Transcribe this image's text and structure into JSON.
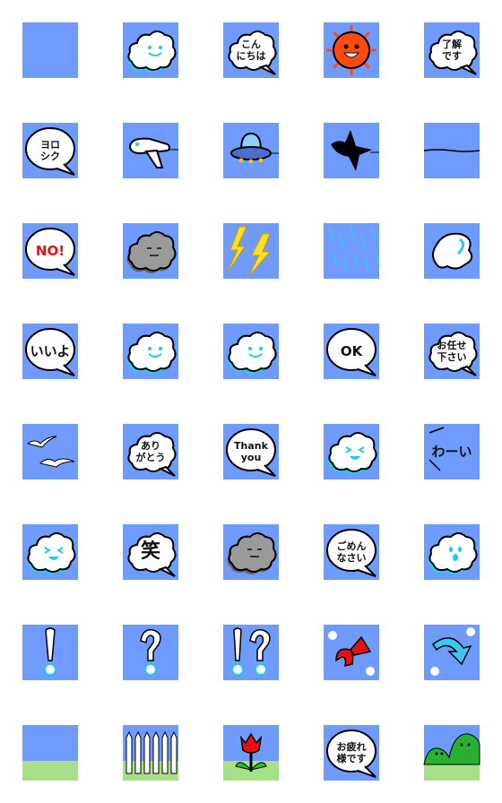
{
  "colors": {
    "tile_bg": "#6f9bff",
    "cloud_shadow": "#22d3f0",
    "sun": "#ff4a10",
    "gray_cloud": "#9a9a9a",
    "lightning": "#ffe020",
    "grass": "#a8e08a",
    "red": "#e81010",
    "arrow_blue": "#3ec8f0"
  },
  "tiles": [
    {
      "icon": "blank"
    },
    {
      "icon": "smiling-cloud"
    },
    {
      "icon": "speech-cloud",
      "lines": [
        "こん",
        "にちは"
      ]
    },
    {
      "icon": "sun"
    },
    {
      "icon": "speech-cloud",
      "lines": [
        "了解",
        "です"
      ]
    },
    {
      "icon": "speech-bubble",
      "lines": [
        "ヨロ",
        "シク"
      ]
    },
    {
      "icon": "airplane"
    },
    {
      "icon": "ufo"
    },
    {
      "icon": "crow"
    },
    {
      "icon": "line"
    },
    {
      "icon": "speech-bubble",
      "lines": [
        "NO!"
      ],
      "red": true
    },
    {
      "icon": "gray-cloud"
    },
    {
      "icon": "lightning"
    },
    {
      "icon": "rain"
    },
    {
      "icon": "swirl-cloud"
    },
    {
      "icon": "speech-bubble",
      "lines": [
        "いいよ"
      ]
    },
    {
      "icon": "smiling-cloud"
    },
    {
      "icon": "smiling-cloud"
    },
    {
      "icon": "speech-bubble",
      "lines": [
        "OK"
      ]
    },
    {
      "icon": "speech-cloud",
      "lines": [
        "お任せ",
        "下さい"
      ]
    },
    {
      "icon": "seagulls"
    },
    {
      "icon": "speech-cloud",
      "lines": [
        "あり",
        "がとう"
      ]
    },
    {
      "icon": "speech-bubble",
      "lines": [
        "Thank",
        "you"
      ]
    },
    {
      "icon": "laughing-cloud"
    },
    {
      "icon": "text",
      "lines": [
        "わーい"
      ]
    },
    {
      "icon": "laughing-cloud"
    },
    {
      "icon": "speech-cloud",
      "lines": [
        "笑"
      ],
      "big": true
    },
    {
      "icon": "gray-cloud"
    },
    {
      "icon": "speech-bubble",
      "lines": [
        "ごめん",
        "なさい"
      ]
    },
    {
      "icon": "surprised-cloud"
    },
    {
      "icon": "exclamation"
    },
    {
      "icon": "question"
    },
    {
      "icon": "exclamation-question"
    },
    {
      "icon": "red-arrow"
    },
    {
      "icon": "blue-arrow"
    },
    {
      "icon": "grass"
    },
    {
      "icon": "fence"
    },
    {
      "icon": "tulip"
    },
    {
      "icon": "speech-bubble",
      "lines": [
        "お疲れ",
        "様です"
      ]
    },
    {
      "icon": "green-hills"
    }
  ]
}
